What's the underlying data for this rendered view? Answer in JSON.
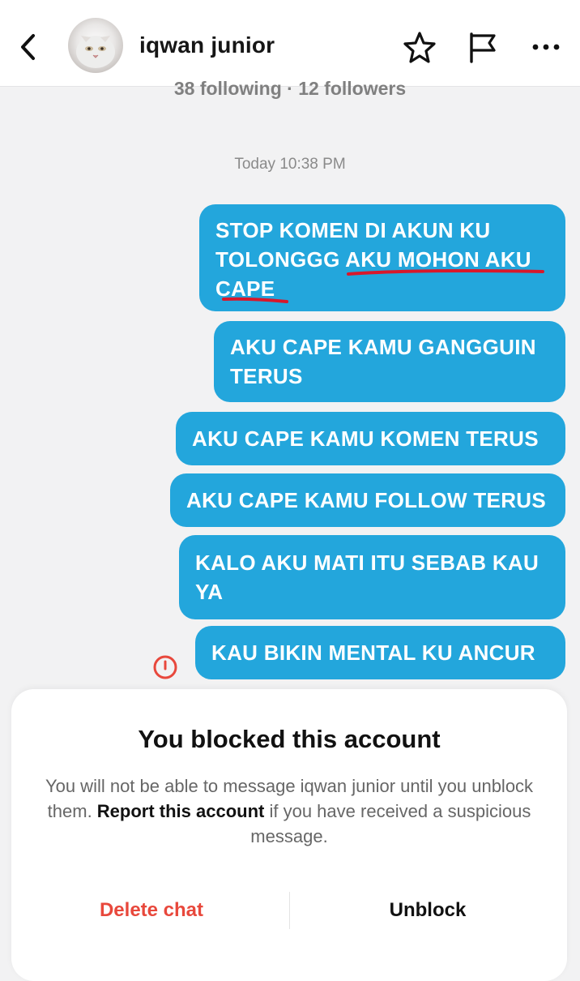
{
  "header": {
    "title": "iqwan junior",
    "subline": "38 following · 12 followers"
  },
  "chat": {
    "timestamp": "Today 10:38 PM",
    "messages": [
      {
        "line1": "STOP KOMEN DI AKUN KU",
        "line2_a": "TOLONGGG ",
        "line2_b": "AKU MOHON AKU",
        "line3": "CAPE"
      },
      {
        "line1": "AKU CAPE KAMU GANGGUIN",
        "line2": "TERUS"
      },
      {
        "line1": "AKU CAPE KAMU KOMEN TERUS"
      },
      {
        "line1": "AKU CAPE KAMU FOLLOW TERUS"
      },
      {
        "line1": "KALO AKU MATI ITU SEBAB KAU",
        "line2": "YA"
      },
      {
        "line1": "KAU BIKIN MENTAL KU ANCUR"
      }
    ]
  },
  "sheet": {
    "title": "You blocked this account",
    "body_part1": "You will not be able to message iqwan junior until you unblock them. ",
    "report_link": "Report this account",
    "body_part2": " if you have received a suspicious message.",
    "delete_label": "Delete chat",
    "unblock_label": "Unblock"
  },
  "colors": {
    "bubble": "#23a6dc",
    "scribble": "#d8182b",
    "delete": "#e8483c",
    "error_icon": "#e8483c"
  },
  "icons": [
    "back-arrow-icon",
    "star-icon",
    "flag-icon",
    "more-icon",
    "error-icon"
  ]
}
